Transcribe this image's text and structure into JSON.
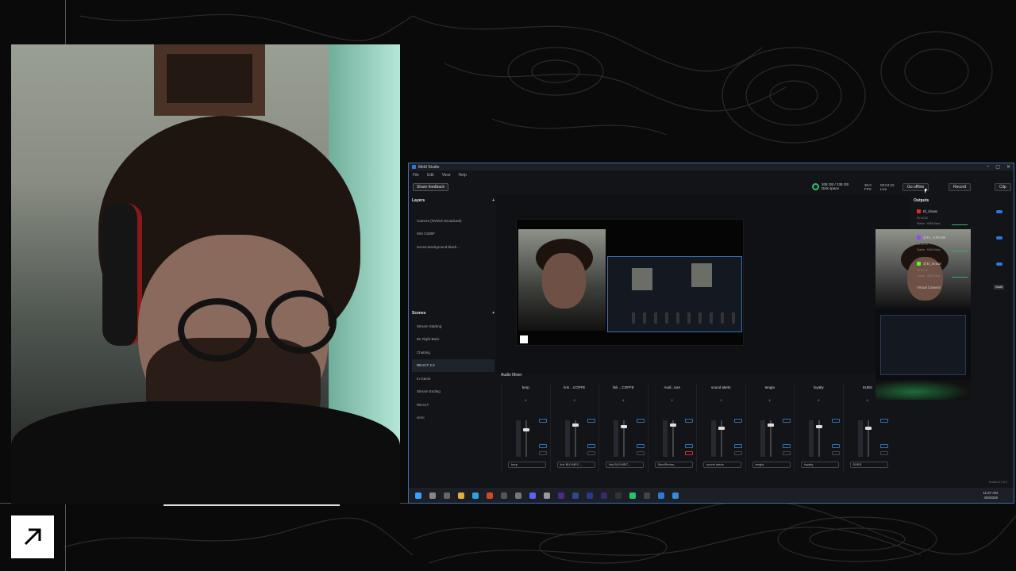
{
  "app": {
    "title": "Meld Studio",
    "window_controls": [
      "–",
      "▢",
      "✕"
    ],
    "menu": [
      "File",
      "Edit",
      "View",
      "Help"
    ]
  },
  "topbar": {
    "share_feedback": "Share feedback",
    "disk_value": "208 GB / 238 GB",
    "disk_label": "Disk space",
    "fps_value": "30.0",
    "fps_label": "FPS",
    "timer_value": "00:04:22",
    "timer_label": "Live",
    "go_offline": "Go offline",
    "record": "Record",
    "clip": "Clip"
  },
  "layers": {
    "title": "Layers",
    "items": [
      "Camera (NVIDIA Broadcast)",
      "MSI G285F",
      "Scene-Background-black..."
    ]
  },
  "scenes": {
    "title": "Scenes",
    "items": [
      "Stream Starting",
      "Be Right Back",
      "Chatting",
      "REACT 2.2",
      "In-Game",
      "Stream Ending",
      "REACT",
      "verzi"
    ],
    "active_index": 3
  },
  "outputs": {
    "title": "Outputs",
    "items": [
      {
        "name": "El_kirawi",
        "sub": "00:04:18",
        "rate": "Stable · 6085 Kbps",
        "color": "#e52d27"
      },
      {
        "name": "@EL_KIRAWI",
        "sub": "00:04:20",
        "rate": "Stable · 6084 Kbps",
        "color": "#9146ff"
      },
      {
        "name": "@El_kirawi",
        "sub": "00:04:22",
        "rate": "Stable · 4994 Kbps",
        "color": "#53fc18"
      }
    ],
    "virtual_camera": "Virtual Camera",
    "install": "Install"
  },
  "mixer": {
    "title": "Audio Mixer",
    "channels": [
      {
        "name": "berp",
        "source": "berp"
      },
      {
        "name": "link ...COFFE",
        "source": "link BUYMEC..."
      },
      {
        "name": "link ...COFFE",
        "source": "link BUYMEC..."
      },
      {
        "name": "Audi...ture",
        "source": "SteelSeries..."
      },
      {
        "name": "sound alerts",
        "source": "sound alerts"
      },
      {
        "name": "tengia",
        "source": "tengia"
      },
      {
        "name": "loyalty",
        "source": "loyalty"
      },
      {
        "name": "SUBS",
        "source": "SUBS"
      }
    ],
    "edit": "EDIT",
    "clip": "CLIP",
    "mute": "MUTE"
  },
  "footer": {
    "version": "Version 0.9.0.2"
  },
  "taskbar": {
    "time": "11:57 AM",
    "date": "4/6/2026"
  },
  "colors": {
    "accent": "#2f7ad8",
    "live_green": "#27c46a",
    "window_border": "#3b6fb0"
  }
}
